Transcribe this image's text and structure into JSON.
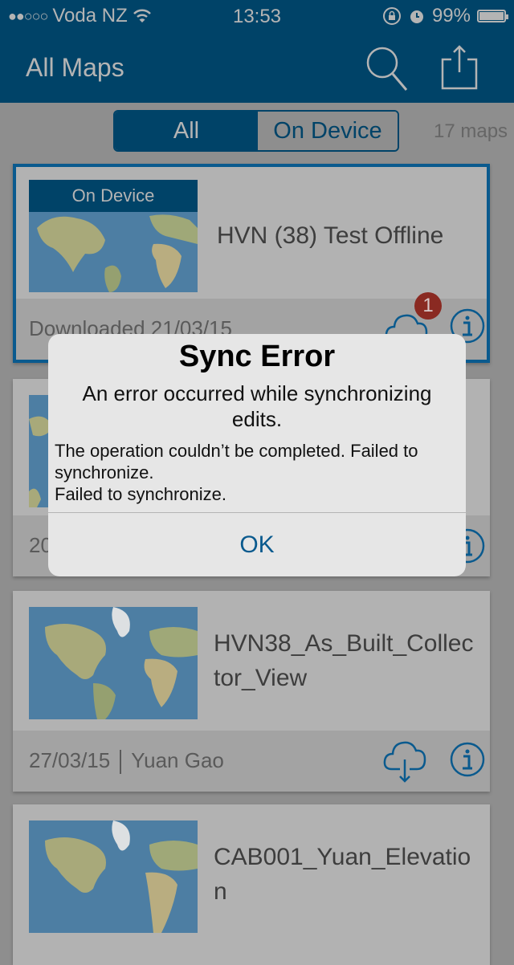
{
  "status_bar": {
    "signal_dots": "●●○○○",
    "carrier": "Voda NZ",
    "wifi_icon": "wifi-icon",
    "time": "13:53",
    "rotation_lock_icon": "rotation-lock-icon",
    "alarm_icon": "alarm-icon",
    "battery_percent": "99%",
    "battery_level": 0.99
  },
  "nav": {
    "title": "All Maps",
    "search_icon": "search-icon",
    "share_icon": "share-icon"
  },
  "filter": {
    "segments": [
      {
        "label": "All",
        "selected": true
      },
      {
        "label": "On Device",
        "selected": false
      }
    ],
    "count": "17 maps"
  },
  "maps": [
    {
      "title": "HVN (38) Test Offline",
      "badge_label": "On Device",
      "footer": "Downloaded 21/03/15",
      "sync_badge_count": "1",
      "selected": true
    },
    {
      "title": "",
      "footer_date": "20",
      "selected": false
    },
    {
      "title": "HVN38_As_Built_Collector_View",
      "footer_date": "27/03/15",
      "footer_owner": "Yuan Gao",
      "selected": false
    },
    {
      "title": "CAB001_Yuan_Elevation",
      "selected": false
    }
  ],
  "dialog": {
    "title": "Sync Error",
    "message": "An error occurred while synchronizing edits.",
    "detail_line1": "The operation couldn’t be completed. Failed to synchronize.",
    "detail_line2": "Failed to synchronize.",
    "ok_label": "OK"
  },
  "colors": {
    "brand": "#004368",
    "accent": "#0a5a8e",
    "badge": "#8a2a22"
  }
}
